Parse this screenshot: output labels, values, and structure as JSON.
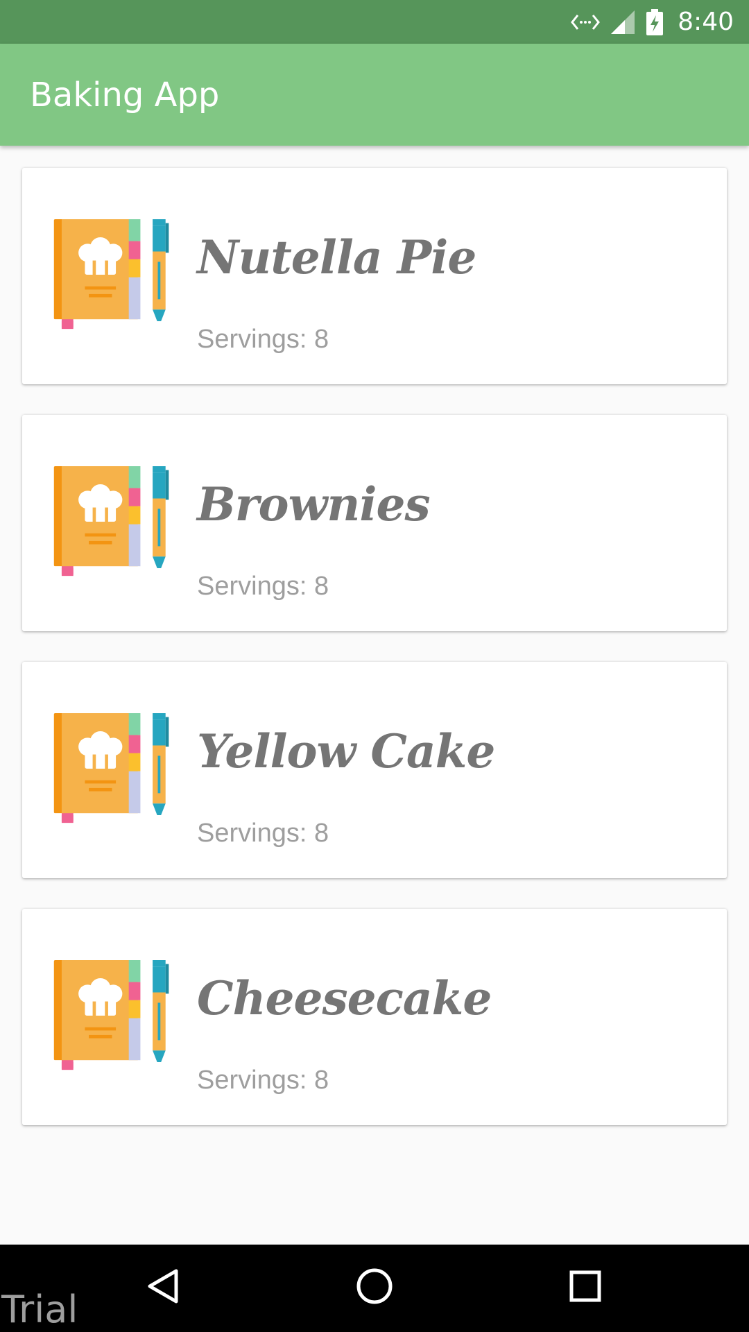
{
  "status_bar": {
    "time": "8:40",
    "icons": [
      "data-sync-icon",
      "signal-icon",
      "battery-charging-icon"
    ]
  },
  "app_bar": {
    "title": "Baking App"
  },
  "recipes": [
    {
      "name": "Nutella Pie",
      "servings": "Servings: 8",
      "icon": "recipe-book-icon"
    },
    {
      "name": "Brownies",
      "servings": "Servings: 8",
      "icon": "recipe-book-icon"
    },
    {
      "name": "Yellow Cake",
      "servings": "Servings: 8",
      "icon": "recipe-book-icon"
    },
    {
      "name": "Cheesecake",
      "servings": "Servings: 8",
      "icon": "recipe-book-icon"
    }
  ],
  "nav_bar": {
    "buttons": [
      "back-icon",
      "home-icon",
      "recents-icon"
    ],
    "watermark": "Trial"
  },
  "colors": {
    "status_bar": "#56955a",
    "app_bar": "#81c784",
    "background": "#fafafa"
  }
}
